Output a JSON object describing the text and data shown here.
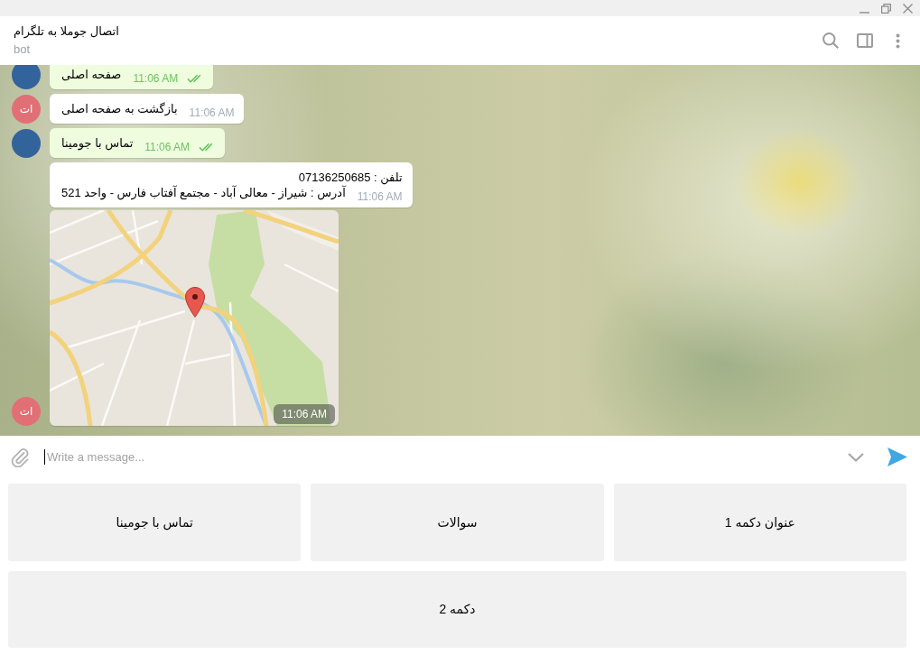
{
  "chat": {
    "title": "اتصال جوملا به تلگرام",
    "status": "bot"
  },
  "messages": [
    {
      "kind": "text",
      "outgoing": true,
      "avatar": {
        "kind": "photo"
      },
      "lines": [
        "صفحه اصلی"
      ],
      "time": "11:06 AM",
      "read": true
    },
    {
      "kind": "text",
      "outgoing": false,
      "avatar": {
        "kind": "initials",
        "text": "ات"
      },
      "lines": [
        "بازگشت به صفحه اصلی"
      ],
      "time": "11:06 AM"
    },
    {
      "kind": "text",
      "outgoing": true,
      "avatar": {
        "kind": "photo"
      },
      "lines": [
        "تماس با جومینا"
      ],
      "time": "11:06 AM",
      "read": true
    },
    {
      "kind": "text",
      "outgoing": false,
      "lines": [
        "تلفن : 07136250685",
        "آدرس : شیراز - معالی آباد - مجتمع آفتاب فارس - واحد 521"
      ],
      "time": "11:06 AM"
    },
    {
      "kind": "location",
      "outgoing": false,
      "avatar": {
        "kind": "initials",
        "text": "ات"
      },
      "time": "11:06 AM"
    }
  ],
  "composer": {
    "placeholder": "Write a message...",
    "focused": true
  },
  "bot_keyboard": [
    {
      "buttons": [
        "عنوان دکمه 1",
        "سوالات",
        "تماس با جومینا"
      ]
    },
    {
      "buttons": [
        "دکمه 2"
      ]
    }
  ]
}
